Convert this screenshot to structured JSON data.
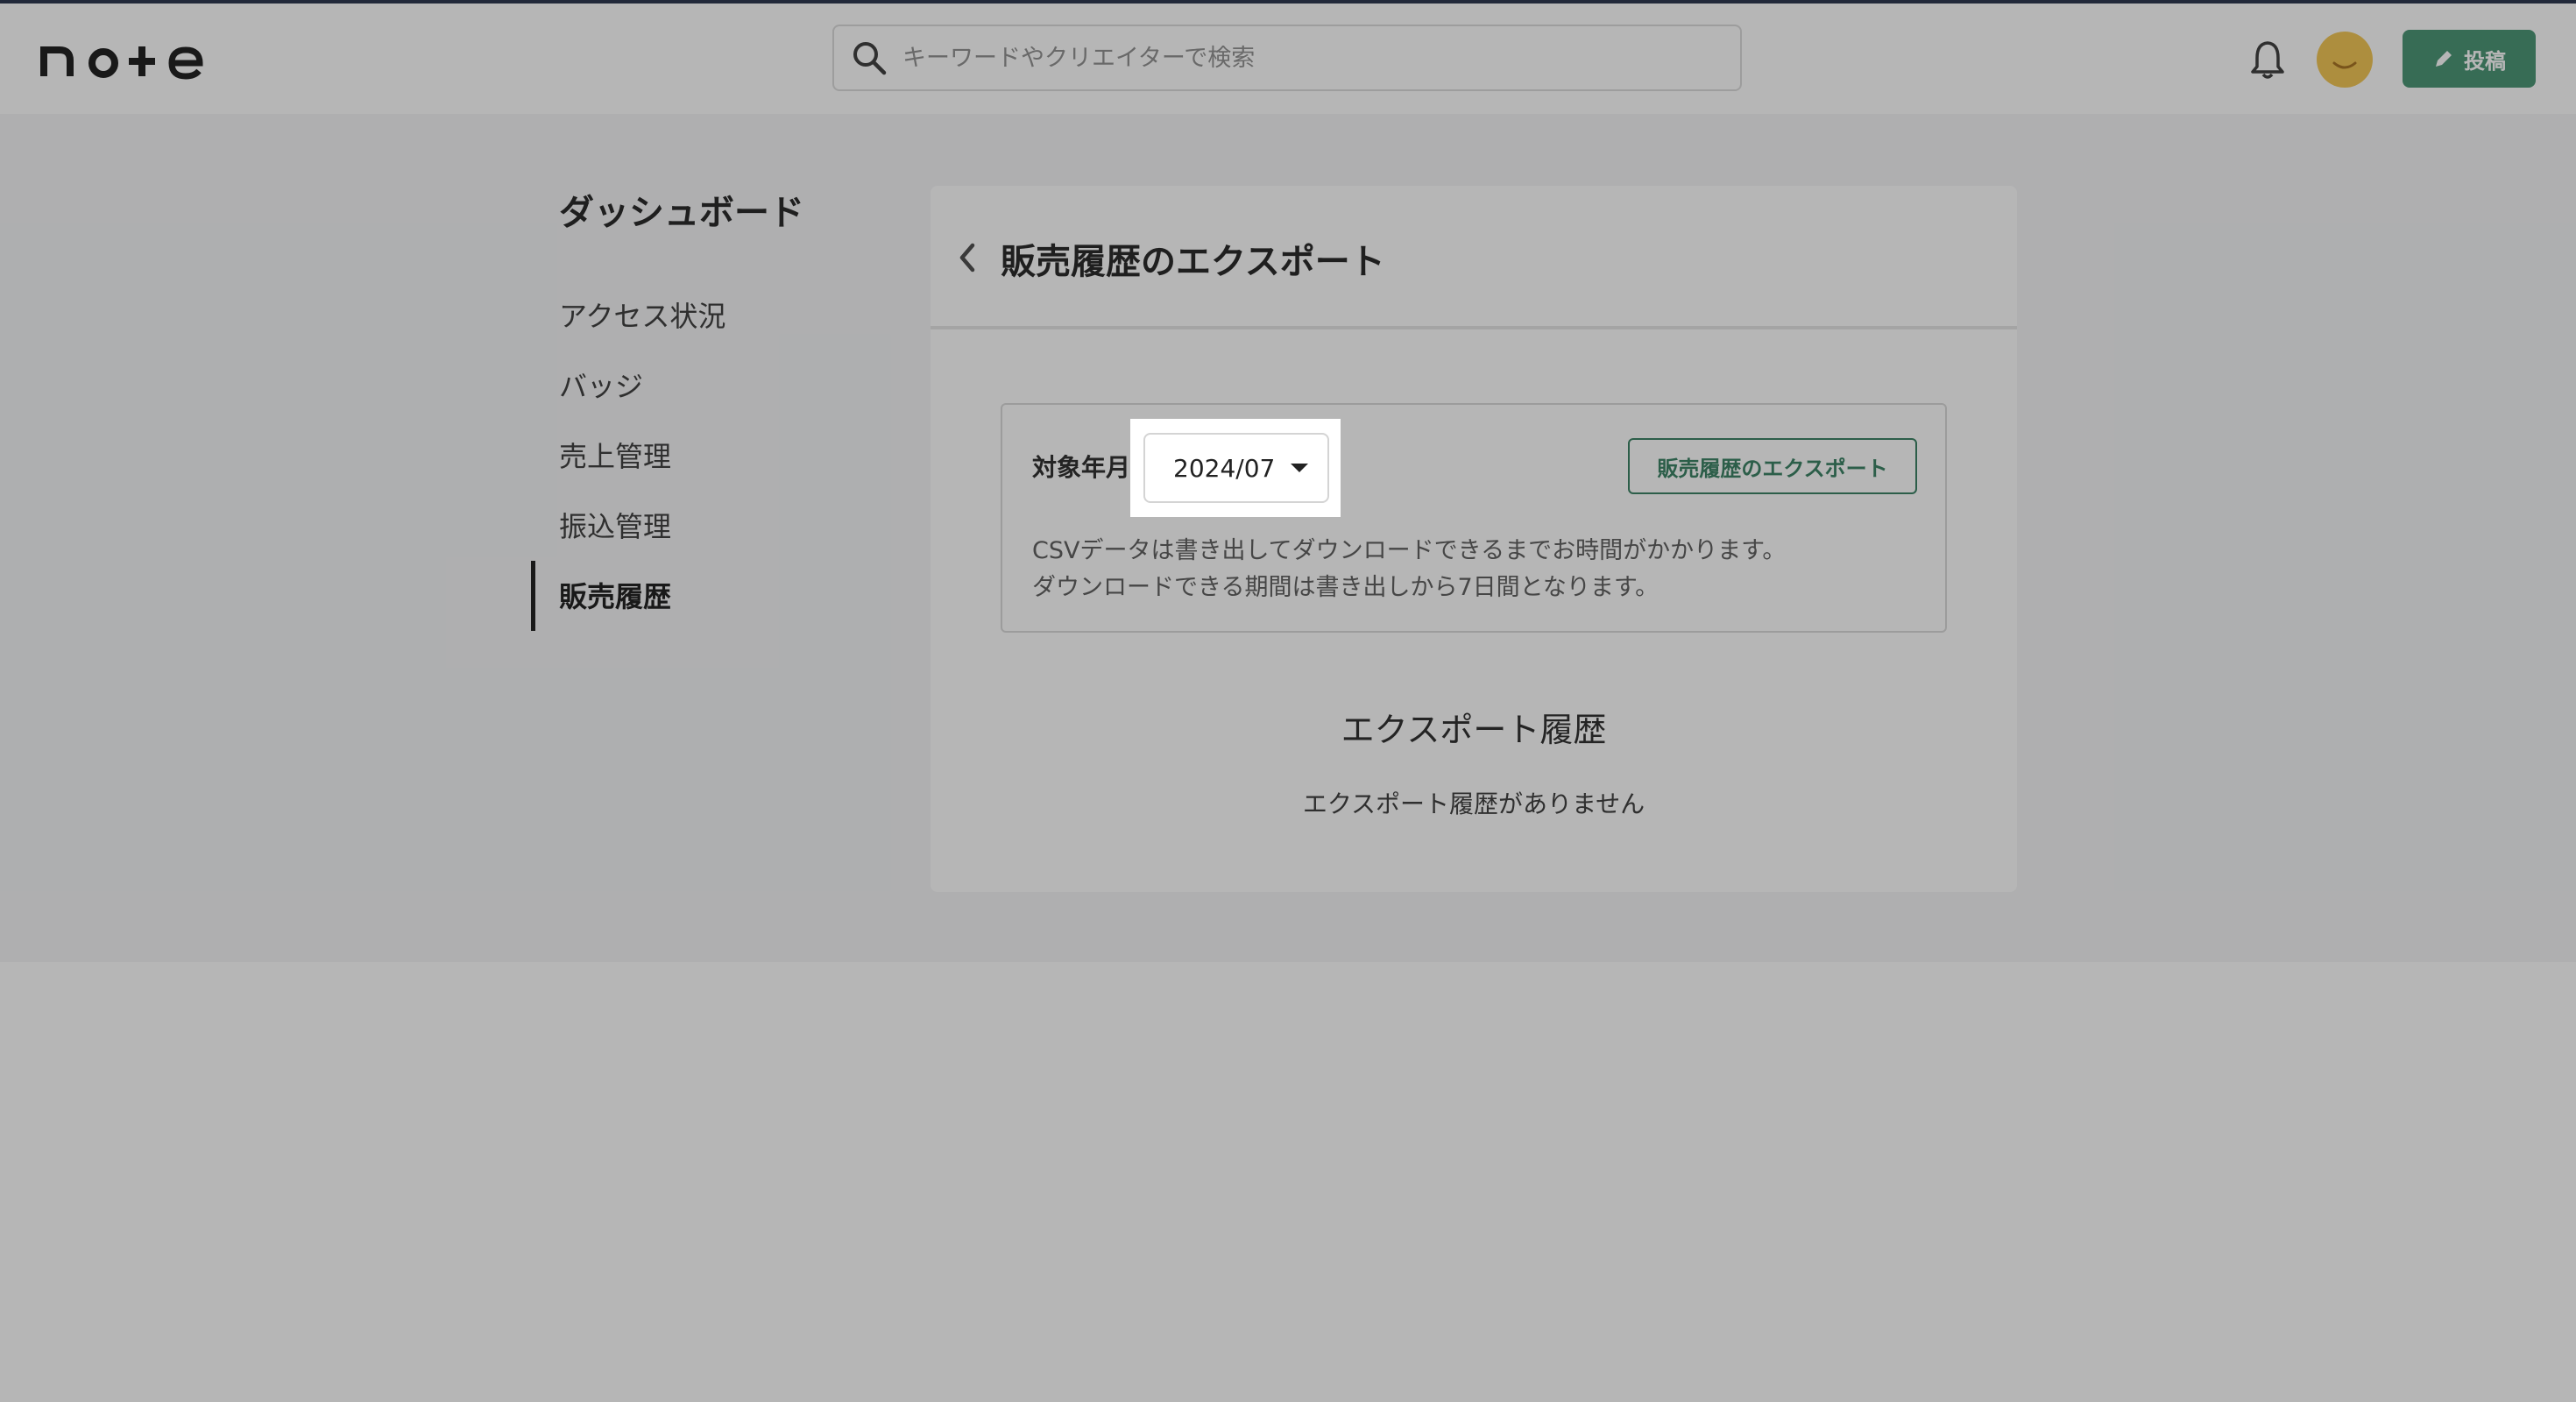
{
  "header": {
    "logo_text": "note",
    "search_placeholder": "キーワードやクリエイターで検索",
    "post_button_label": "投稿"
  },
  "sidebar": {
    "title": "ダッシュボード",
    "items": [
      {
        "label": "アクセス状況",
        "active": false
      },
      {
        "label": "バッジ",
        "active": false
      },
      {
        "label": "売上管理",
        "active": false
      },
      {
        "label": "振込管理",
        "active": false
      },
      {
        "label": "販売履歴",
        "active": true
      }
    ]
  },
  "main": {
    "title": "販売履歴のエクスポート",
    "form": {
      "label": "対象年月",
      "selected_month": "2024/07",
      "export_button_label": "販売履歴のエクスポート",
      "notes": [
        "CSVデータは書き出してダウンロードできるまでお時間がかかります。",
        "ダウンロードできる期間は書き出しから7日間となります。"
      ]
    },
    "history": {
      "title": "エクスポート履歴",
      "empty_message": "エクスポート履歴がありません"
    }
  },
  "colors": {
    "accent_green": "#3f8f6d",
    "avatar_yellow": "#f2c34a",
    "overlay": "rgba(40,40,40,0.34)"
  },
  "icons": [
    "search-icon",
    "bell-icon",
    "avatar",
    "pencil-icon",
    "chevron-left-icon",
    "caret-down-icon"
  ]
}
